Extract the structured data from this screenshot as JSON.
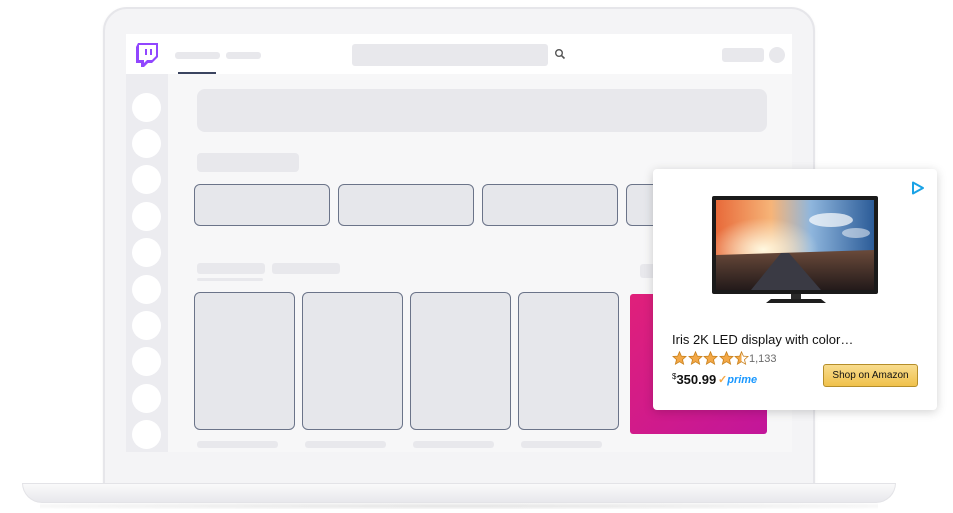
{
  "ad": {
    "product_title": "Iris 2K LED display with color…",
    "rating_count": "1,133",
    "rating": 4.5,
    "price_currency": "$",
    "price": "350.99",
    "prime_label": "prime",
    "prime_check": "✓",
    "shop_button_label": "Shop on Amazon"
  },
  "icons": {
    "logo": "twitch-logo-icon",
    "search": "search-icon",
    "ad_choices": "ad-choices-icon"
  },
  "colors": {
    "brand": "#9146ff",
    "promo": "#e0207a",
    "star": "#f3a847",
    "prime": "#1a98ff",
    "button": "#f0c14b",
    "card_border": "#6b7489"
  }
}
